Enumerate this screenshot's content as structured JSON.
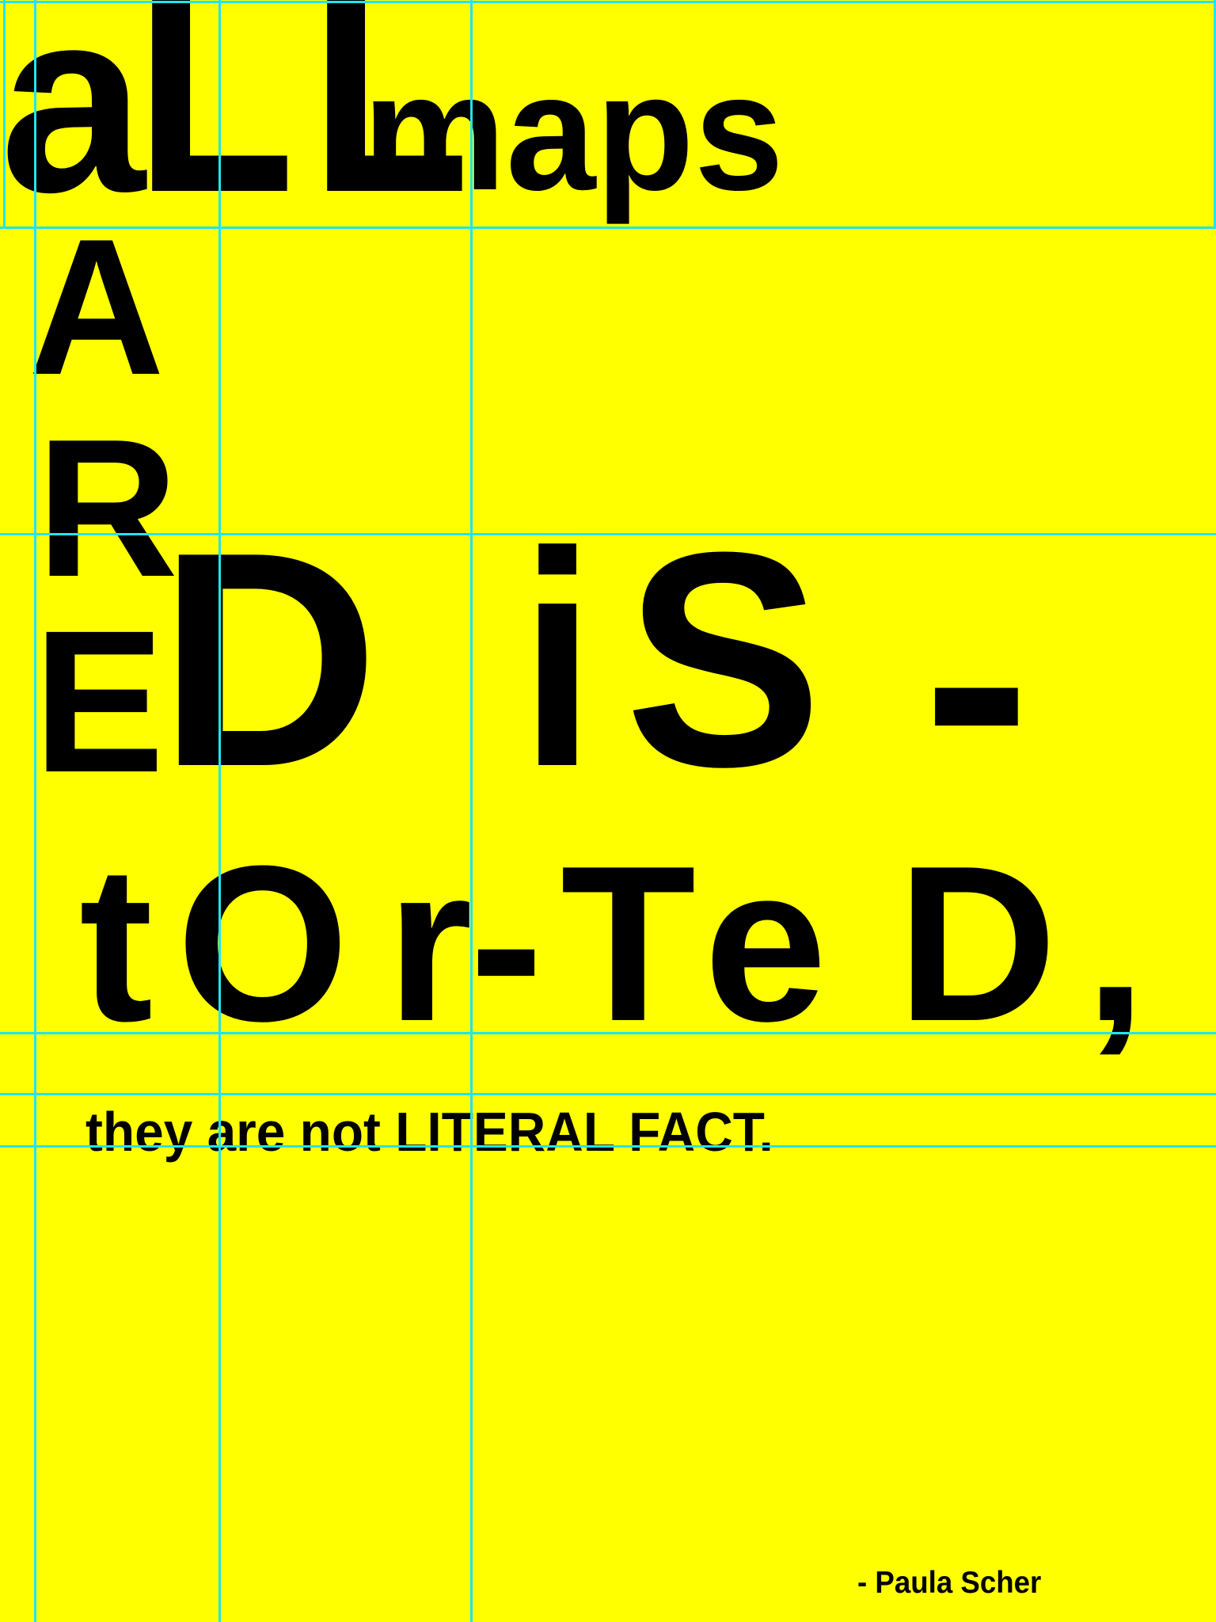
{
  "poster": {
    "background": "#ffff00",
    "text_color": "#000000",
    "guide_color": "#22e4f2",
    "line1": {
      "a": "a",
      "l1": "L",
      "l2": "L",
      "maps": "maps"
    },
    "vertical": {
      "a": "A",
      "r": "R",
      "e": "E"
    },
    "line2": {
      "d": "D",
      "i": "i",
      "s": "S",
      "dash": "-"
    },
    "line3": {
      "t": "t",
      "o": "O",
      "r": "r",
      "dash": "-",
      "t2": "T",
      "e": "e",
      "d": "D",
      "comma": ","
    },
    "subline": "they are not LITERAL FACT.",
    "attribution": "- Paula Scher"
  }
}
